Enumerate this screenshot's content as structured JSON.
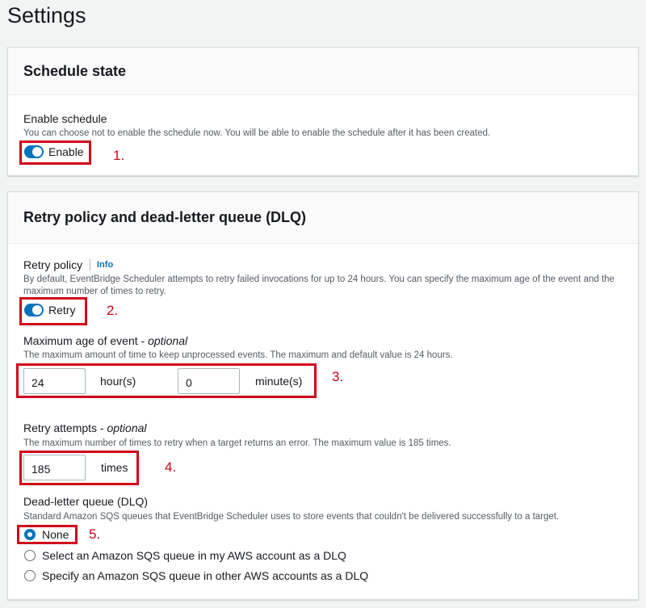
{
  "page": {
    "title": "Settings"
  },
  "schedule_state": {
    "title": "Schedule state",
    "enable_label": "Enable schedule",
    "enable_desc": "You can choose not to enable the schedule now. You will be able to enable the schedule after it has been created.",
    "toggle_label": "Enable",
    "toggle_on": true,
    "marker": "1."
  },
  "retry": {
    "title": "Retry policy and dead-letter queue (DLQ)",
    "policy_label": "Retry policy",
    "info": "Info",
    "policy_desc": "By default, EventBridge Scheduler attempts to retry failed invocations for up to 24 hours. You can specify the maximum age of the event and the maximum number of times to retry.",
    "toggle_label": "Retry",
    "toggle_on": true,
    "marker": "2."
  },
  "max_age": {
    "label": "Maximum age of event - ",
    "optional": "optional",
    "desc": "The maximum amount of time to keep unprocessed events. The maximum and default value is 24 hours.",
    "hours_value": "24",
    "hours_unit": "hour(s)",
    "minutes_value": "0",
    "minutes_unit": "minute(s)",
    "marker": "3."
  },
  "attempts": {
    "label": "Retry attempts - ",
    "optional": "optional",
    "desc": "The maximum number of times to retry when a target returns an error. The maximum value is 185 times.",
    "value": "185",
    "unit": "times",
    "marker": "4."
  },
  "dlq": {
    "label": "Dead-letter queue (DLQ)",
    "desc": "Standard Amazon SQS queues that EventBridge Scheduler uses to store events that couldn't be delivered successfully to a target.",
    "options": [
      {
        "label": "None",
        "checked": true
      },
      {
        "label": "Select an Amazon SQS queue in my AWS account as a DLQ",
        "checked": false
      },
      {
        "label": "Specify an Amazon SQS queue in other AWS accounts as a DLQ",
        "checked": false
      }
    ],
    "marker": "5."
  },
  "colors": {
    "accent": "#0073bb",
    "annotation": "#d0021b"
  }
}
